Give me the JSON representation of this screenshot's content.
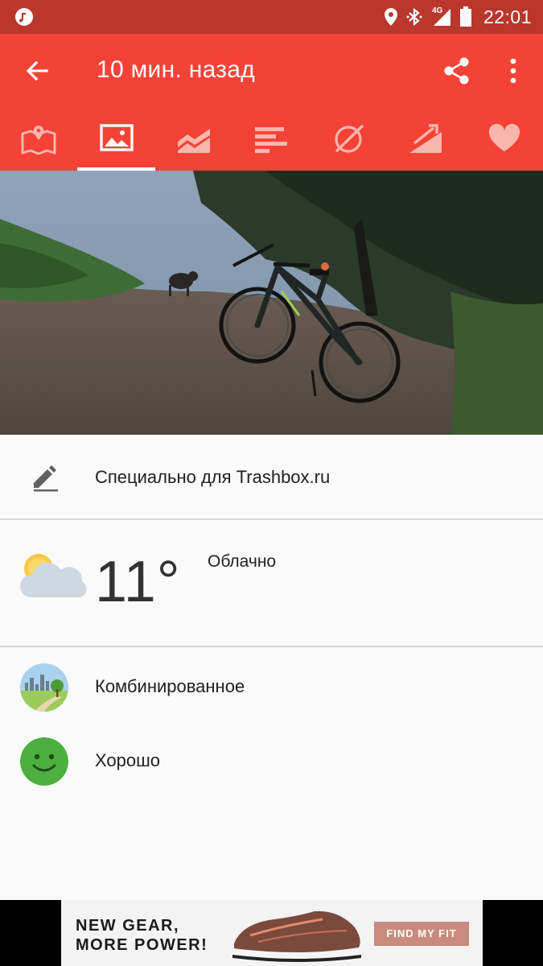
{
  "status_bar": {
    "time": "22:01",
    "network_label": "4G",
    "icons": [
      "music-note-icon",
      "location-icon",
      "bluetooth-icon",
      "signal-icon",
      "battery-icon"
    ]
  },
  "app_bar": {
    "title": "10 мин. назад",
    "icons": [
      "back-arrow-icon",
      "share-icon",
      "more-vert-icon"
    ]
  },
  "tabs": [
    {
      "icon": "map-icon",
      "active": false
    },
    {
      "icon": "photo-icon",
      "active": true
    },
    {
      "icon": "chart-area-icon",
      "active": false
    },
    {
      "icon": "bar-chart-icon",
      "active": false
    },
    {
      "icon": "route-icon",
      "active": false
    },
    {
      "icon": "elevation-icon",
      "active": false
    },
    {
      "icon": "heart-icon",
      "active": false
    }
  ],
  "note": {
    "text": "Специально для Trashbox.ru",
    "icon": "edit-icon"
  },
  "weather": {
    "temperature": "11°",
    "condition": "Облачно",
    "icon": "partly-cloudy-icon"
  },
  "sport": {
    "label": "Комбинированное",
    "icon": "landscape-icon"
  },
  "mood": {
    "label": "Хорошо",
    "icon": "smiley-icon"
  },
  "ad": {
    "headline_line1": "NEW GEAR,",
    "headline_line2": "MORE POWER!",
    "cta": "FIND MY FIT"
  },
  "colors": {
    "accent": "#f44336",
    "status_bar": "#b9372c",
    "background": "#fafafa",
    "mood_green": "#4caf3f"
  }
}
